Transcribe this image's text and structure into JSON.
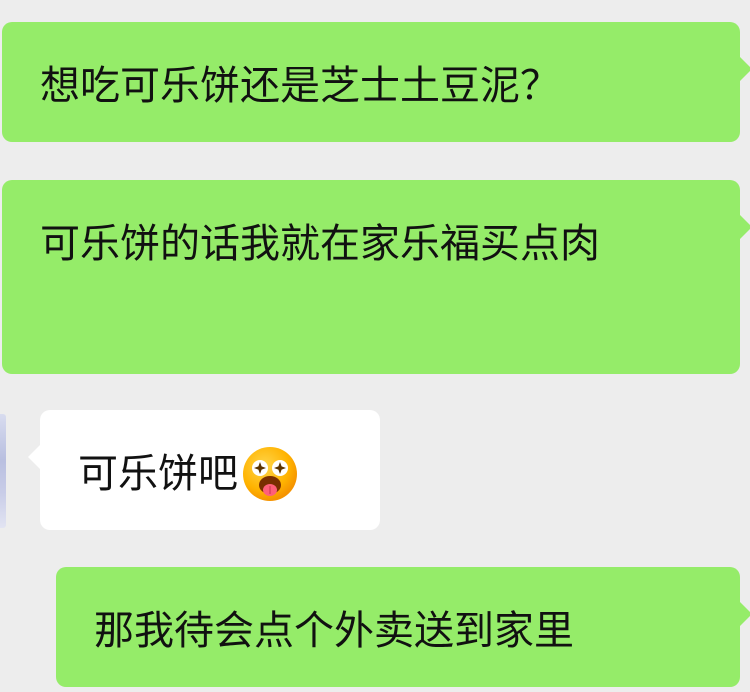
{
  "chat": {
    "messages": [
      {
        "direction": "sent",
        "text": "想吃可乐饼还是芝士土豆泥？"
      },
      {
        "direction": "sent",
        "text": "可乐饼的话我就在家乐福买点肉"
      },
      {
        "direction": "received",
        "text": "可乐饼吧",
        "emoji": "starry-eyed-tongue-out-emoji"
      },
      {
        "direction": "sent",
        "text": "那我待会点个外卖送到家里"
      }
    ]
  },
  "colors": {
    "background": "#ededed",
    "sent_bubble": "#95ec69",
    "received_bubble": "#ffffff",
    "text": "#111111"
  }
}
